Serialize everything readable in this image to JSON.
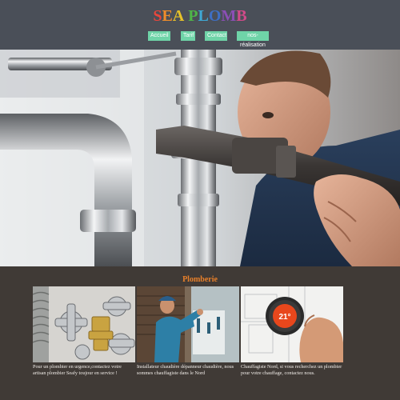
{
  "header": {
    "logo_text": "SEA PLOMB",
    "logo_colors": [
      "#e8463c",
      "#f08c2a",
      "#e6c229",
      "#4fb548",
      "#3fa9d6",
      "#3e6fc4",
      "#8b4fb5",
      "#d14a8a",
      "#e8463c"
    ]
  },
  "nav": {
    "items": [
      {
        "label": "Accueil"
      },
      {
        "label": "Tarif"
      },
      {
        "label": "Contact"
      },
      {
        "label": "nos-réalisation"
      }
    ],
    "item_color": "#6fd4a8"
  },
  "section": {
    "title": "Plomberie",
    "cards": [
      {
        "image": "plumbing-fittings-photo",
        "text": "Pour un plombier en urgence,contactez votre artisan plombier Seafy toujour en service !"
      },
      {
        "image": "plumber-at-work-photo",
        "text": "Installateur chaudière dépanneur chaudière, nous sommes chauffagiste dans le Nord"
      },
      {
        "image": "thermostat-photo",
        "text": "Chauffagiste Nord, si vous recherchez un plombier pour votre chauffage, contactez nous.",
        "thermostat_reading": "21°"
      }
    ]
  },
  "colors": {
    "header_bg": "#4a4f58",
    "section_bg": "#403a36",
    "title_accent": "#e9802a"
  }
}
